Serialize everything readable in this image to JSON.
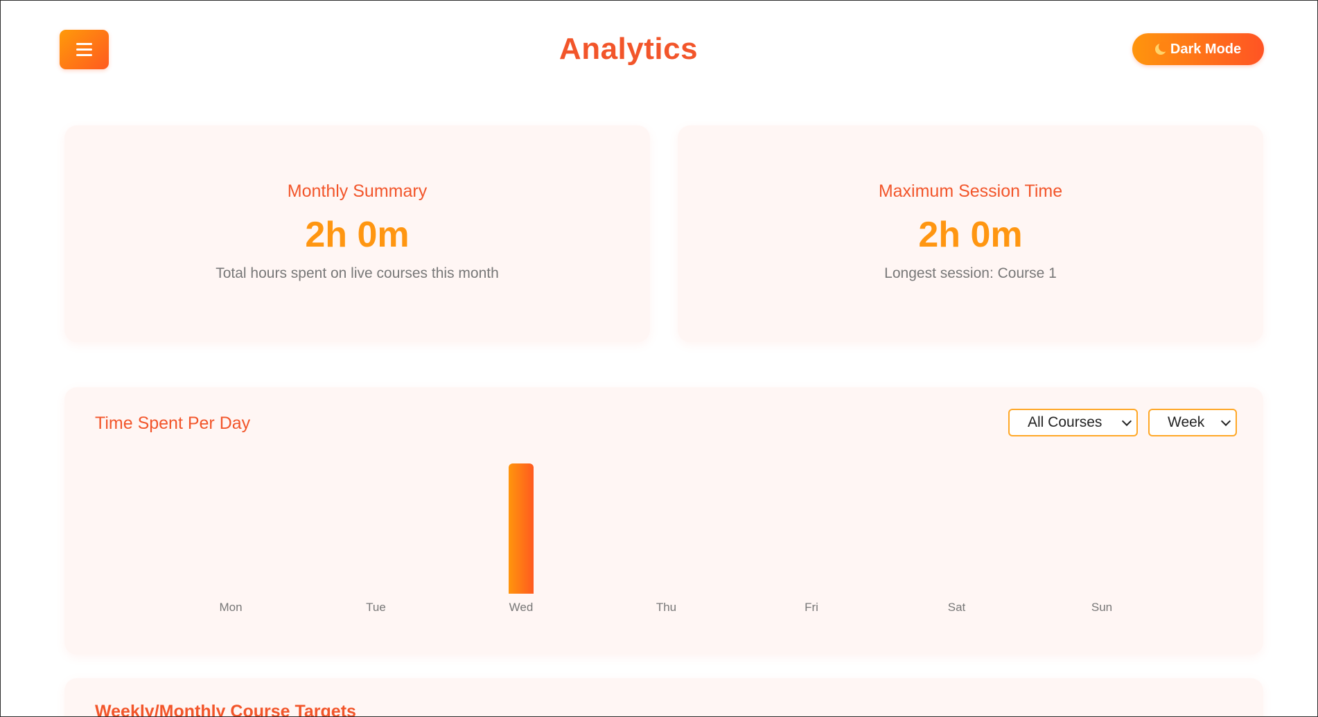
{
  "header": {
    "menu_icon": "hamburger-menu-icon",
    "title": "Analytics",
    "dark_mode_label": "Dark Mode",
    "dark_mode_icon": "moon-icon"
  },
  "summary": {
    "monthly": {
      "label": "Monthly Summary",
      "value": "2h 0m",
      "description": "Total hours spent on live courses this month"
    },
    "max_session": {
      "label": "Maximum Session Time",
      "value": "2h 0m",
      "description": "Longest session: Course 1"
    }
  },
  "time_chart": {
    "title": "Time Spent Per Day",
    "course_filter": "All Courses",
    "period_filter": "Week"
  },
  "targets": {
    "title": "Weekly/Monthly Course Targets"
  },
  "colors": {
    "accent": "#f2552a",
    "accent_light": "#ff9611",
    "card_bg": "#fff6f4"
  },
  "chart_data": {
    "type": "bar",
    "categories": [
      "Mon",
      "Tue",
      "Wed",
      "Thu",
      "Fri",
      "Sat",
      "Sun"
    ],
    "values": [
      0,
      0,
      2,
      0,
      0,
      0,
      0
    ],
    "ylim": [
      0,
      2
    ],
    "grid": false
  }
}
